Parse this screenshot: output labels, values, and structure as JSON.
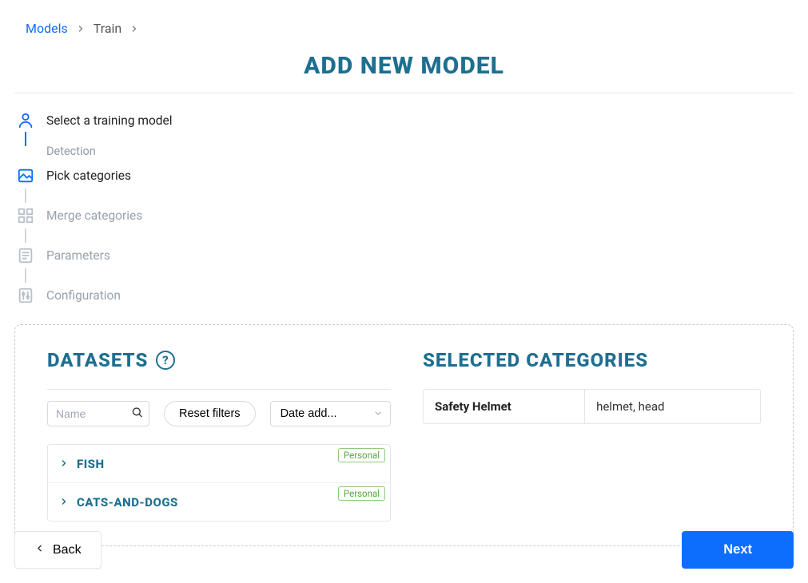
{
  "breadcrumb": {
    "root": "Models",
    "current": "Train"
  },
  "page_title": "ADD NEW MODEL",
  "stepper": {
    "step1": {
      "label": "Select a training model",
      "sublabel": "Detection"
    },
    "step2": {
      "label": "Pick categories"
    },
    "step3": {
      "label": "Merge categories"
    },
    "step4": {
      "label": "Parameters"
    },
    "step5": {
      "label": "Configuration"
    }
  },
  "datasets": {
    "heading": "DATASETS",
    "help": "?",
    "search_placeholder": "Name",
    "reset_label": "Reset filters",
    "sort_label": "Date add...",
    "items": [
      {
        "name": "FISH",
        "badge": "Personal"
      },
      {
        "name": "CATS-AND-DOGS",
        "badge": "Personal"
      }
    ]
  },
  "selected": {
    "heading": "SELECTED CATEGORIES",
    "rows": [
      {
        "name": "Safety Helmet",
        "values": "helmet, head"
      }
    ]
  },
  "buttons": {
    "back": "Back",
    "next": "Next"
  }
}
